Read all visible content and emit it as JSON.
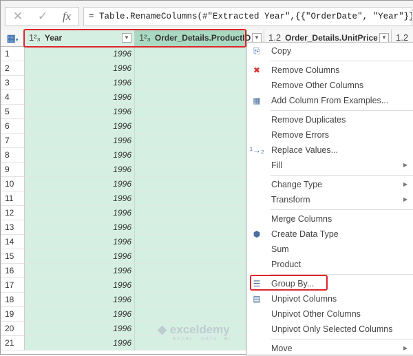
{
  "formula_bar": {
    "cancel_icon": "✕",
    "confirm_icon": "✓",
    "fx_label": "fx",
    "formula": "= Table.RenameColumns(#\"Extracted Year\",{{\"OrderDate\", \"Year\"}})"
  },
  "columns": [
    {
      "type": "1²₃",
      "name": "Year"
    },
    {
      "type": "1²₃",
      "name": "Order_Details.ProductID"
    },
    {
      "type": "1.2",
      "name": "Order_Details.UnitPrice"
    },
    {
      "type": "1.2",
      "name": ""
    }
  ],
  "rows": [
    {
      "n": "1",
      "year": "1996"
    },
    {
      "n": "2",
      "year": "1996"
    },
    {
      "n": "3",
      "year": "1996"
    },
    {
      "n": "4",
      "year": "1996"
    },
    {
      "n": "5",
      "year": "1996"
    },
    {
      "n": "6",
      "year": "1996"
    },
    {
      "n": "7",
      "year": "1996"
    },
    {
      "n": "8",
      "year": "1996"
    },
    {
      "n": "9",
      "year": "1996"
    },
    {
      "n": "10",
      "year": "1996"
    },
    {
      "n": "11",
      "year": "1996"
    },
    {
      "n": "12",
      "year": "1996"
    },
    {
      "n": "13",
      "year": "1996"
    },
    {
      "n": "14",
      "year": "1996"
    },
    {
      "n": "15",
      "year": "1996"
    },
    {
      "n": "16",
      "year": "1996"
    },
    {
      "n": "17",
      "year": "1996"
    },
    {
      "n": "18",
      "year": "1996"
    },
    {
      "n": "19",
      "year": "1996"
    },
    {
      "n": "20",
      "year": "1996"
    },
    {
      "n": "21",
      "year": "1996"
    }
  ],
  "menu": [
    {
      "label": "Copy",
      "icon": "copy-icon",
      "glyph": "⎘"
    },
    {
      "sep": true
    },
    {
      "label": "Remove Columns",
      "icon": "remove-columns-icon",
      "glyph": "✖"
    },
    {
      "label": "Remove Other Columns"
    },
    {
      "label": "Add Column From Examples...",
      "icon": "add-column-examples-icon",
      "glyph": "▦"
    },
    {
      "sep": true
    },
    {
      "label": "Remove Duplicates"
    },
    {
      "label": "Remove Errors"
    },
    {
      "label": "Replace Values...",
      "icon": "replace-values-icon",
      "glyph": "¹→₂"
    },
    {
      "label": "Fill",
      "submenu": true
    },
    {
      "sep": true
    },
    {
      "label": "Change Type",
      "submenu": true
    },
    {
      "label": "Transform",
      "submenu": true
    },
    {
      "sep": true
    },
    {
      "label": "Merge Columns"
    },
    {
      "label": "Create Data Type",
      "icon": "data-type-icon",
      "glyph": "⬢"
    },
    {
      "label": "Sum"
    },
    {
      "label": "Product"
    },
    {
      "sep": true
    },
    {
      "label": "Group By...",
      "icon": "group-by-icon",
      "glyph": "☰",
      "highlight": true
    },
    {
      "label": "Unpivot Columns",
      "icon": "unpivot-icon",
      "glyph": "▤"
    },
    {
      "label": "Unpivot Other Columns"
    },
    {
      "label": "Unpivot Only Selected Columns"
    },
    {
      "sep": true
    },
    {
      "label": "Move",
      "submenu": true
    }
  ],
  "watermark": {
    "name": "exceldemy",
    "tagline": "EXCEL · DATA · BI"
  },
  "colors": {
    "selected_column": "#d6efe3",
    "highlight": "#e0242b"
  }
}
